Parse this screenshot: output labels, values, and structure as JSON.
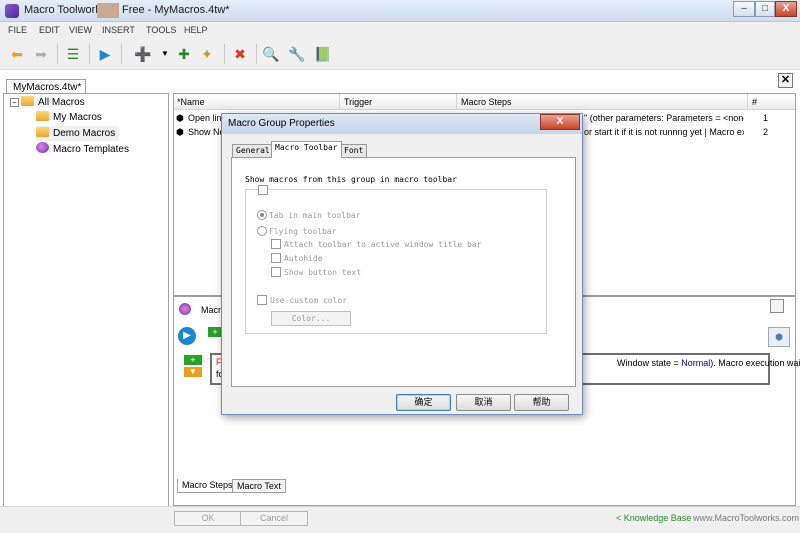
{
  "window": {
    "app_name": "Macro Toolworks",
    "title_suffix": "Free - MyMacros.4tw*",
    "minimize": "–",
    "maximize": "□",
    "close": "X"
  },
  "menu": [
    "FILE",
    "EDIT",
    "VIEW",
    "INSERT",
    "TOOLS",
    "HELP"
  ],
  "toolbar": {
    "icons": [
      "back-arrow-icon",
      "forward-arrow-icon",
      "macro-list-icon",
      "play-icon",
      "add-macro-icon",
      "add-group-icon",
      "import-icon",
      "stop-icon",
      "search-icon",
      "settings-wrench-icon",
      "help-book-icon"
    ]
  },
  "document_tab": "MyMacros.4tw*",
  "tree": {
    "items": [
      "All Macros",
      "My Macros",
      "Demo Macros",
      "Macro Templates"
    ]
  },
  "grid": {
    "columns": [
      "*Name",
      "Trigger",
      "Macro Steps",
      "#"
    ],
    "rows": [
      {
        "name": "Open link",
        "steps": "\" (other parameters: Parameters = <none>, ...",
        "num": "1"
      },
      {
        "name": "Show No",
        "steps": "or start it if it is not runnng yet | Macro exec...",
        "num": "2"
      }
    ]
  },
  "lower": {
    "panel_label": "Macro",
    "step_prefix": "F",
    "step_prefix2": "fo",
    "step_text_start": "Window state = ",
    "step_text_link": "Normal",
    "step_text_end": "). Macro execution waits",
    "tabs": [
      "Macro Steps",
      "Macro Text"
    ]
  },
  "footer": {
    "ok": "OK",
    "cancel": "Cancel",
    "knowledge_base": "< Knowledge Base",
    "website": "www.MacroToolworks.com"
  },
  "dialog": {
    "title": "Macro Group Properties",
    "close": "X",
    "tabs": [
      "General",
      "Macro Toolbar",
      "Font"
    ],
    "active_tab": "Macro Toolbar",
    "show_macros_label": "Show macros from this group in macro toolbar",
    "tab_in_main": "Tab in main toolbar",
    "flying": "Flying toolbar",
    "attach": "Attach toolbar to active window title bar",
    "autohide": "Autohide",
    "show_button_text": "Show button text",
    "use_custom_color": "Use custom color",
    "color_button": "Color...",
    "ok": "确定",
    "cancel": "取消",
    "help": "帮助"
  },
  "colors": {
    "accent_link": "#0000cc",
    "kb_link": "#2a8a2a",
    "dialog_border": "#6d8db8"
  }
}
